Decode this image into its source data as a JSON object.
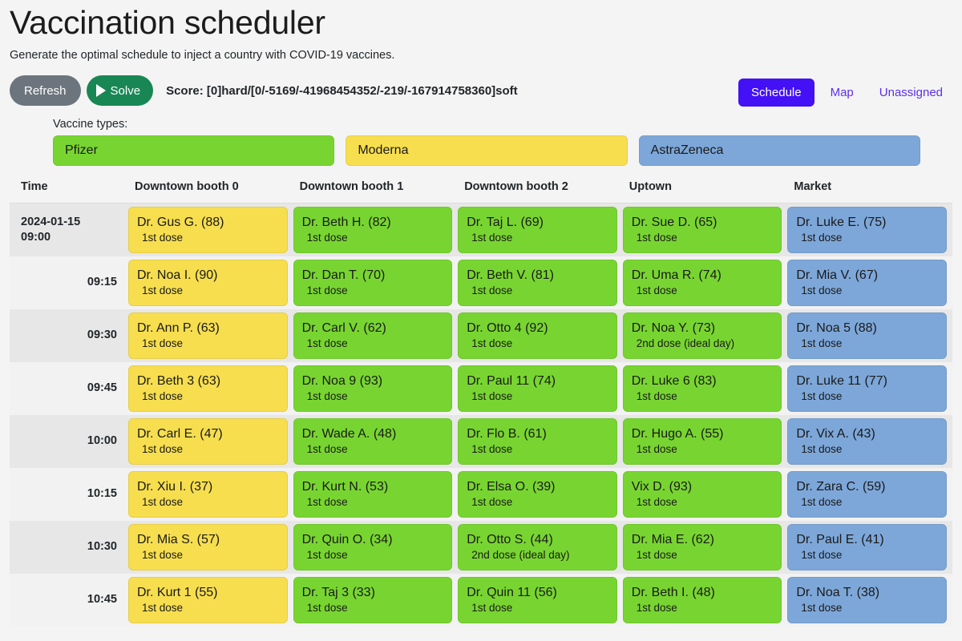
{
  "header": {
    "title": "Vaccination scheduler",
    "subtitle": "Generate the optimal schedule to inject a country with COVID-19 vaccines."
  },
  "toolbar": {
    "refresh_label": "Refresh",
    "solve_label": "Solve",
    "score_text": "Score: [0]hard/[0/-5169/-41968454352/-219/-167914758360]soft"
  },
  "nav": {
    "items": [
      {
        "label": "Schedule",
        "active": true
      },
      {
        "label": "Map",
        "active": false
      },
      {
        "label": "Unassigned",
        "active": false
      }
    ],
    "active_color": "#4410f5",
    "link_color": "#5b2ef0"
  },
  "vaccines": {
    "label": "Vaccine types:",
    "types": [
      {
        "name": "Pfizer",
        "color": "#78d531"
      },
      {
        "name": "Moderna",
        "color": "#f7de4f"
      },
      {
        "name": "AstraZeneca",
        "color": "#7da7d9"
      }
    ]
  },
  "schedule": {
    "columns": [
      "Time",
      "Downtown booth 0",
      "Downtown booth 1",
      "Downtown booth 2",
      "Uptown",
      "Market"
    ],
    "rows": [
      {
        "date": "2024-01-15",
        "time": "09:00",
        "first_of_day": true,
        "slots": [
          {
            "name": "Dr. Gus G. (88)",
            "dose": "1st dose",
            "vaccine": "Moderna"
          },
          {
            "name": "Dr. Beth H. (82)",
            "dose": "1st dose",
            "vaccine": "Pfizer"
          },
          {
            "name": "Dr. Taj L. (69)",
            "dose": "1st dose",
            "vaccine": "Pfizer"
          },
          {
            "name": "Dr. Sue D. (65)",
            "dose": "1st dose",
            "vaccine": "Pfizer"
          },
          {
            "name": "Dr. Luke E. (75)",
            "dose": "1st dose",
            "vaccine": "AstraZeneca"
          }
        ]
      },
      {
        "date": "",
        "time": "09:15",
        "first_of_day": false,
        "slots": [
          {
            "name": "Dr. Noa I. (90)",
            "dose": "1st dose",
            "vaccine": "Moderna"
          },
          {
            "name": "Dr. Dan T. (70)",
            "dose": "1st dose",
            "vaccine": "Pfizer"
          },
          {
            "name": "Dr. Beth V. (81)",
            "dose": "1st dose",
            "vaccine": "Pfizer"
          },
          {
            "name": "Dr. Uma R. (74)",
            "dose": "1st dose",
            "vaccine": "Pfizer"
          },
          {
            "name": "Dr. Mia V. (67)",
            "dose": "1st dose",
            "vaccine": "AstraZeneca"
          }
        ]
      },
      {
        "date": "",
        "time": "09:30",
        "first_of_day": false,
        "slots": [
          {
            "name": "Dr. Ann P. (63)",
            "dose": "1st dose",
            "vaccine": "Moderna"
          },
          {
            "name": "Dr. Carl V. (62)",
            "dose": "1st dose",
            "vaccine": "Pfizer"
          },
          {
            "name": "Dr. Otto 4 (92)",
            "dose": "1st dose",
            "vaccine": "Pfizer"
          },
          {
            "name": "Dr. Noa Y. (73)",
            "dose": "2nd dose (ideal day)",
            "vaccine": "Pfizer"
          },
          {
            "name": "Dr. Noa 5 (88)",
            "dose": "1st dose",
            "vaccine": "AstraZeneca"
          }
        ]
      },
      {
        "date": "",
        "time": "09:45",
        "first_of_day": false,
        "slots": [
          {
            "name": "Dr. Beth 3 (63)",
            "dose": "1st dose",
            "vaccine": "Moderna"
          },
          {
            "name": "Dr. Noa 9 (93)",
            "dose": "1st dose",
            "vaccine": "Pfizer"
          },
          {
            "name": "Dr. Paul 11 (74)",
            "dose": "1st dose",
            "vaccine": "Pfizer"
          },
          {
            "name": "Dr. Luke 6 (83)",
            "dose": "1st dose",
            "vaccine": "Pfizer"
          },
          {
            "name": "Dr. Luke 11 (77)",
            "dose": "1st dose",
            "vaccine": "AstraZeneca"
          }
        ]
      },
      {
        "date": "",
        "time": "10:00",
        "first_of_day": false,
        "slots": [
          {
            "name": "Dr. Carl E. (47)",
            "dose": "1st dose",
            "vaccine": "Moderna"
          },
          {
            "name": "Dr. Wade A. (48)",
            "dose": "1st dose",
            "vaccine": "Pfizer"
          },
          {
            "name": "Dr. Flo B. (61)",
            "dose": "1st dose",
            "vaccine": "Pfizer"
          },
          {
            "name": "Dr. Hugo A. (55)",
            "dose": "1st dose",
            "vaccine": "Pfizer"
          },
          {
            "name": "Dr. Vix A. (43)",
            "dose": "1st dose",
            "vaccine": "AstraZeneca"
          }
        ]
      },
      {
        "date": "",
        "time": "10:15",
        "first_of_day": false,
        "slots": [
          {
            "name": "Dr. Xiu I. (37)",
            "dose": "1st dose",
            "vaccine": "Moderna"
          },
          {
            "name": "Dr. Kurt N. (53)",
            "dose": "1st dose",
            "vaccine": "Pfizer"
          },
          {
            "name": "Dr. Elsa O. (39)",
            "dose": "1st dose",
            "vaccine": "Pfizer"
          },
          {
            "name": "Vix D. (93)",
            "dose": "1st dose",
            "vaccine": "Pfizer"
          },
          {
            "name": "Dr. Zara C. (59)",
            "dose": "1st dose",
            "vaccine": "AstraZeneca"
          }
        ]
      },
      {
        "date": "",
        "time": "10:30",
        "first_of_day": false,
        "slots": [
          {
            "name": "Dr. Mia S. (57)",
            "dose": "1st dose",
            "vaccine": "Moderna"
          },
          {
            "name": "Dr. Quin O. (34)",
            "dose": "1st dose",
            "vaccine": "Pfizer"
          },
          {
            "name": "Dr. Otto S. (44)",
            "dose": "2nd dose (ideal day)",
            "vaccine": "Pfizer"
          },
          {
            "name": "Dr. Mia E. (62)",
            "dose": "1st dose",
            "vaccine": "Pfizer"
          },
          {
            "name": "Dr. Paul E. (41)",
            "dose": "1st dose",
            "vaccine": "AstraZeneca"
          }
        ]
      },
      {
        "date": "",
        "time": "10:45",
        "first_of_day": false,
        "slots": [
          {
            "name": "Dr. Kurt 1 (55)",
            "dose": "1st dose",
            "vaccine": "Moderna"
          },
          {
            "name": "Dr. Taj 3 (33)",
            "dose": "1st dose",
            "vaccine": "Pfizer"
          },
          {
            "name": "Dr. Quin 11 (56)",
            "dose": "1st dose",
            "vaccine": "Pfizer"
          },
          {
            "name": "Dr. Beth I. (48)",
            "dose": "1st dose",
            "vaccine": "Pfizer"
          },
          {
            "name": "Dr. Noa T. (38)",
            "dose": "1st dose",
            "vaccine": "AstraZeneca"
          }
        ]
      }
    ]
  }
}
